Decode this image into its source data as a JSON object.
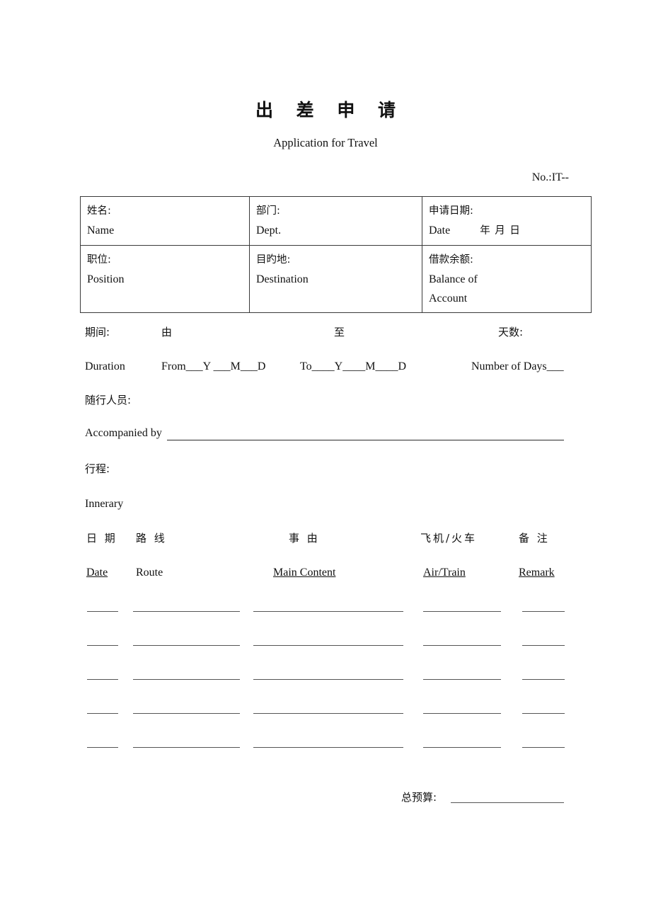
{
  "document": {
    "title_cn": "出  差  申  请",
    "title_en": "Application for Travel",
    "doc_number": "No.:IT--"
  },
  "info_table": {
    "rows": [
      {
        "cells": [
          {
            "cn": "姓名:",
            "en": "Name",
            "suffix": ""
          },
          {
            "cn": "部门:",
            "en": "Dept.",
            "suffix": ""
          },
          {
            "cn": "申请日期:",
            "en": "Date",
            "suffix": "年   月   日"
          }
        ]
      },
      {
        "cells": [
          {
            "cn": "职位:",
            "en": "Position",
            "en2": ""
          },
          {
            "cn": "目旳地:",
            "en": "Destination",
            "en2": ""
          },
          {
            "cn": "借款余额:",
            "en": "Balance of",
            "en2": "Account"
          }
        ]
      }
    ]
  },
  "duration": {
    "label_cn": "期间:",
    "from_cn": "由",
    "to_cn": "至",
    "days_cn": "天数:",
    "label_en": "Duration",
    "from_en": "From___Y ___M___D",
    "to_en": "To____Y____M____D",
    "days_en": "Number of Days___"
  },
  "accompanied": {
    "label_cn": "随行人员:",
    "label_en": "Accompanied by"
  },
  "itinerary": {
    "label_cn": "行程:",
    "label_en": "Innerary",
    "columns": [
      {
        "cn": "日 期",
        "en": "Date",
        "underline_en": true
      },
      {
        "cn": "路 线",
        "en": "Route",
        "underline_en": false
      },
      {
        "cn": "事 由",
        "en": "Main Content",
        "underline_en": true
      },
      {
        "cn": "飞机/火车",
        "en": "Air/Train",
        "underline_en": true
      },
      {
        "cn": "备 注",
        "en": "Remark",
        "underline_en": true
      }
    ],
    "blank_row_count": 5
  },
  "budget": {
    "label_cn": "总预算:"
  }
}
